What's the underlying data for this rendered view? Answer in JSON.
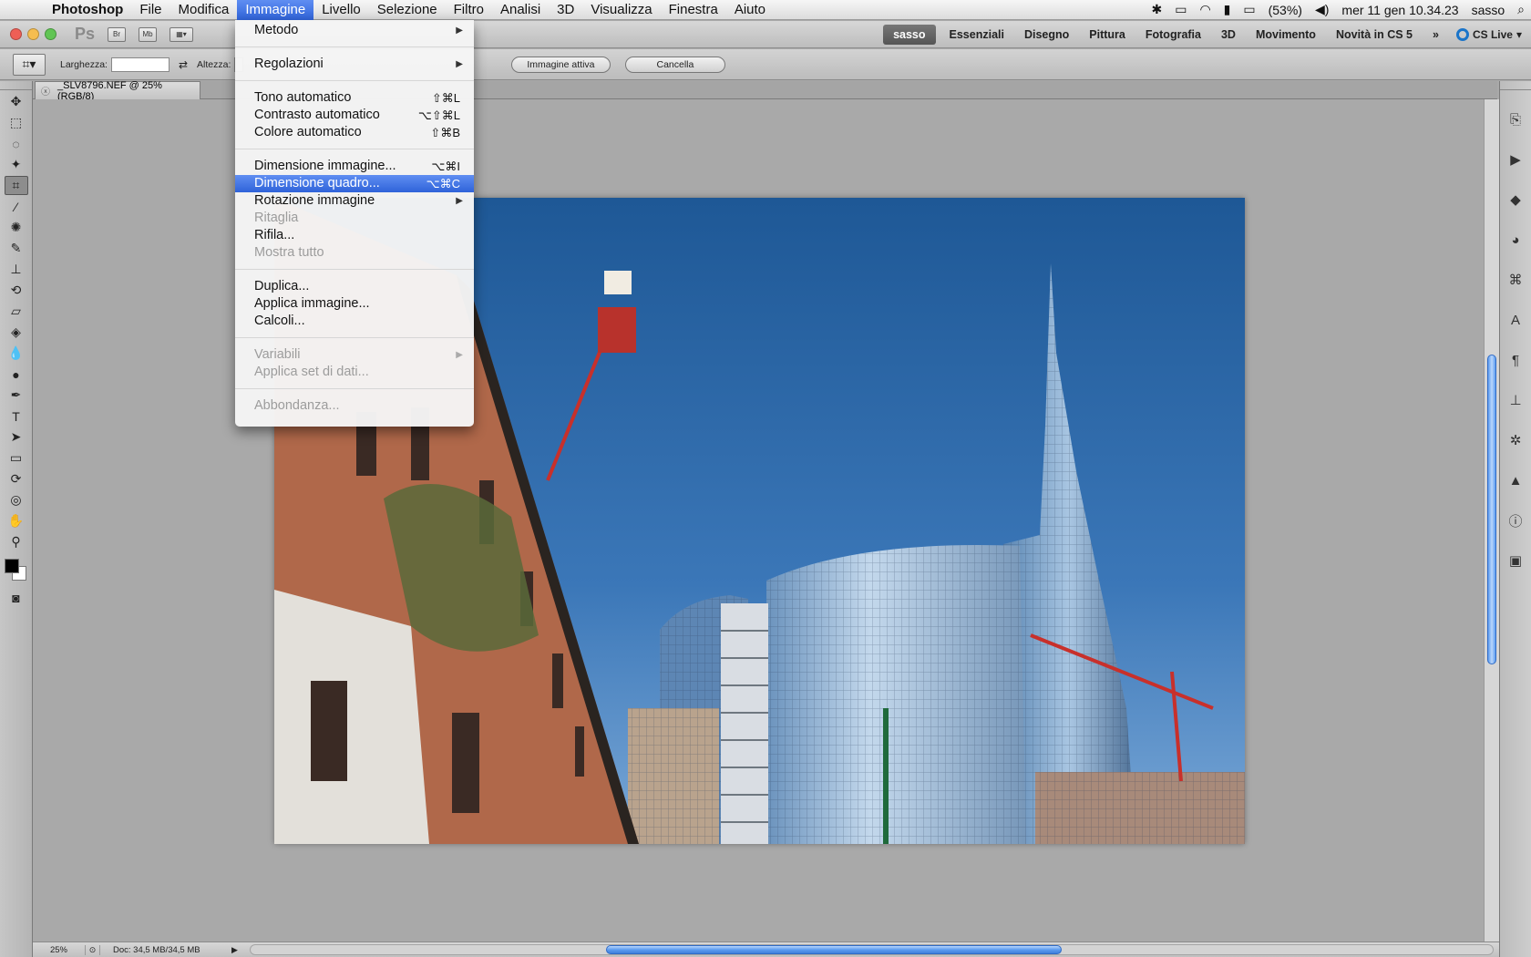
{
  "menubar": {
    "app_name": "Photoshop",
    "items": [
      "File",
      "Modifica",
      "Immagine",
      "Livello",
      "Selezione",
      "Filtro",
      "Analisi",
      "3D",
      "Visualizza",
      "Finestra",
      "Aiuto"
    ],
    "active_item": "Immagine",
    "battery": "(53%)",
    "clock": "mer 11 gen  10.34.23",
    "user": "sasso"
  },
  "appbar": {
    "logo": "Ps",
    "bridge_label": "Br",
    "minibridge_label": "Mb",
    "workspaces": [
      "sasso",
      "Essenziali",
      "Disegno",
      "Pittura",
      "Fotografia",
      "3D",
      "Movimento",
      "Novità in CS 5"
    ],
    "selected_workspace": "sasso",
    "cs_live": "CS Live"
  },
  "options": {
    "width_label": "Larghezza:",
    "height_label": "Altezza:",
    "active_image_button": "Immagine attiva",
    "cancel_button": "Cancella"
  },
  "document": {
    "tab_title": "_SLV8796.NEF @ 25% (RGB/8)"
  },
  "statusbar": {
    "zoom": "25%",
    "doc_info": "Doc: 34,5 MB/34,5 MB"
  },
  "menu": {
    "title": "Immagine",
    "items": [
      {
        "label": "Metodo",
        "submenu": true
      },
      {
        "label": "Regolazioni",
        "submenu": true
      },
      {
        "label": "Tono automatico",
        "shortcut": "⇧⌘L"
      },
      {
        "label": "Contrasto automatico",
        "shortcut": "⌥⇧⌘L"
      },
      {
        "label": "Colore automatico",
        "shortcut": "⇧⌘B"
      },
      {
        "label": "Dimensione immagine...",
        "shortcut": "⌥⌘I"
      },
      {
        "label": "Dimensione quadro...",
        "shortcut": "⌥⌘C",
        "highlighted": true
      },
      {
        "label": "Rotazione immagine",
        "submenu": true
      },
      {
        "label": "Ritaglia",
        "disabled": true
      },
      {
        "label": "Rifila..."
      },
      {
        "label": "Mostra tutto",
        "disabled": true
      },
      {
        "label": "Duplica..."
      },
      {
        "label": "Applica immagine..."
      },
      {
        "label": "Calcoli..."
      },
      {
        "label": "Variabili",
        "submenu": true,
        "disabled": true
      },
      {
        "label": "Applica set di dati...",
        "disabled": true
      },
      {
        "label": "Abbondanza...",
        "disabled": true
      }
    ]
  },
  "colors": {
    "highlight": "#2f63d9",
    "foreground_color": "#000000",
    "background_color": "#ffffff"
  }
}
